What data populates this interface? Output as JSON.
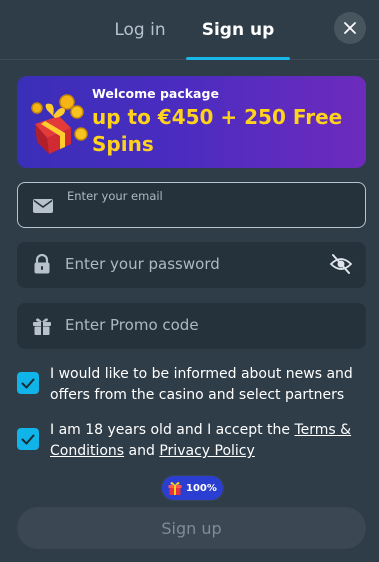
{
  "tabs": {
    "login_label": "Log in",
    "signup_label": "Sign up",
    "active": "signup"
  },
  "banner": {
    "subtitle": "Welcome package",
    "title": "up to €450 + 250 Free Spins",
    "icon": "gift-coins-icon"
  },
  "email": {
    "label": "Enter your email",
    "value": "",
    "icon": "envelope-icon"
  },
  "password": {
    "placeholder": "Enter your password",
    "value": "",
    "icon": "lock-icon",
    "toggle_icon": "eye-off-icon"
  },
  "promo": {
    "placeholder": "Enter Promo code",
    "value": "",
    "icon": "gift-icon"
  },
  "consents": {
    "news_text": "I would like to be informed about news and offers from the casino and select partners",
    "news_checked": true,
    "age_text_before": "I am 18 years old and I accept the ",
    "terms_link": "Terms & Conditions",
    "age_text_and": " and ",
    "privacy_link": "Privacy Policy",
    "age_checked": true
  },
  "progress": {
    "label": "100%",
    "icon": "gift-icon"
  },
  "submit": {
    "label": "Sign up"
  },
  "colors": {
    "background": "#2f3d48",
    "accent": "#19b6e8",
    "banner_highlight": "#ffd21c",
    "progress_pill": "#2a3fd1"
  }
}
